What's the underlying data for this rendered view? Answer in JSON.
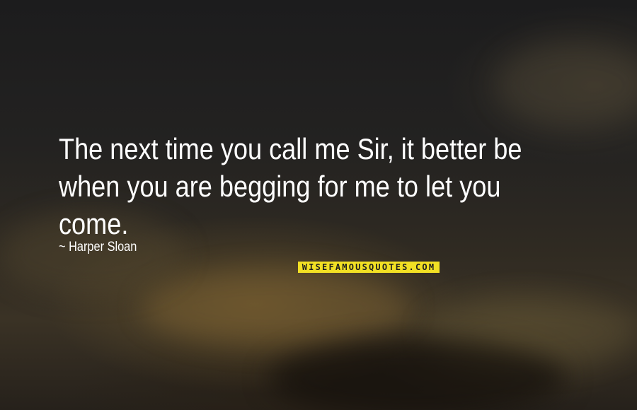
{
  "quote": {
    "lines": [
      "The next time you call me Sir, it better be",
      "when you are begging for me to let you",
      "come."
    ],
    "author": "~ Harper Sloan"
  },
  "watermark": {
    "text": "WISEFAMOUSQUOTES.COM",
    "color": "#f2e024"
  },
  "background": {
    "colors": [
      "#1c1c1d",
      "#2f2a22",
      "#3a3225"
    ]
  }
}
